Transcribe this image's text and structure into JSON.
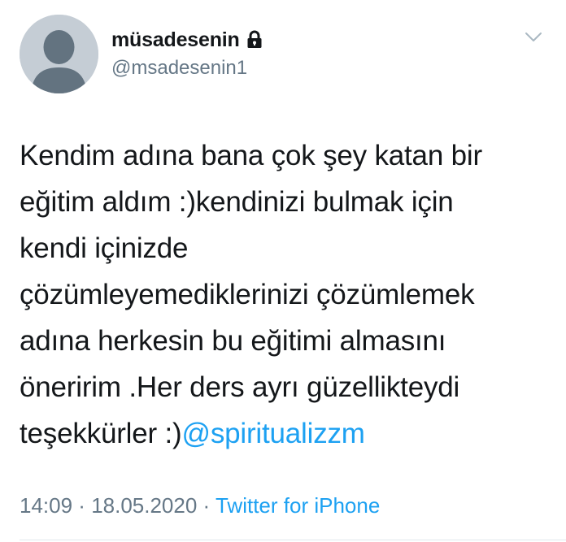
{
  "user": {
    "display_name": "müsadesenin",
    "handle": "@msadesenin1",
    "protected_icon": "lock-icon",
    "avatar_icon": "default-avatar-icon"
  },
  "menu": {
    "icon": "chevron-down-icon"
  },
  "tweet": {
    "lines": [
      "Kendim adına bana çok şey katan bir",
      "eğitim aldım :)kendinizi bulmak için",
      "kendi içinizde",
      "çözümleyemediklerinizi çözümlemek",
      "adına herkesin bu eğitimi almasını",
      "öneririm .Her ders ayrı güzellikteydi",
      "teşekkürler :)"
    ],
    "mention": "@spiritualizzm"
  },
  "meta": {
    "time": "14:09",
    "separator1": " · ",
    "date": "18.05.2020",
    "separator2": " · ",
    "source": "Twitter for iPhone"
  },
  "colors": {
    "link": "#1da1f2",
    "secondary_text": "#657786",
    "primary_text": "#14171a",
    "avatar_bg": "#c5cdd5",
    "avatar_fg": "#637380"
  }
}
